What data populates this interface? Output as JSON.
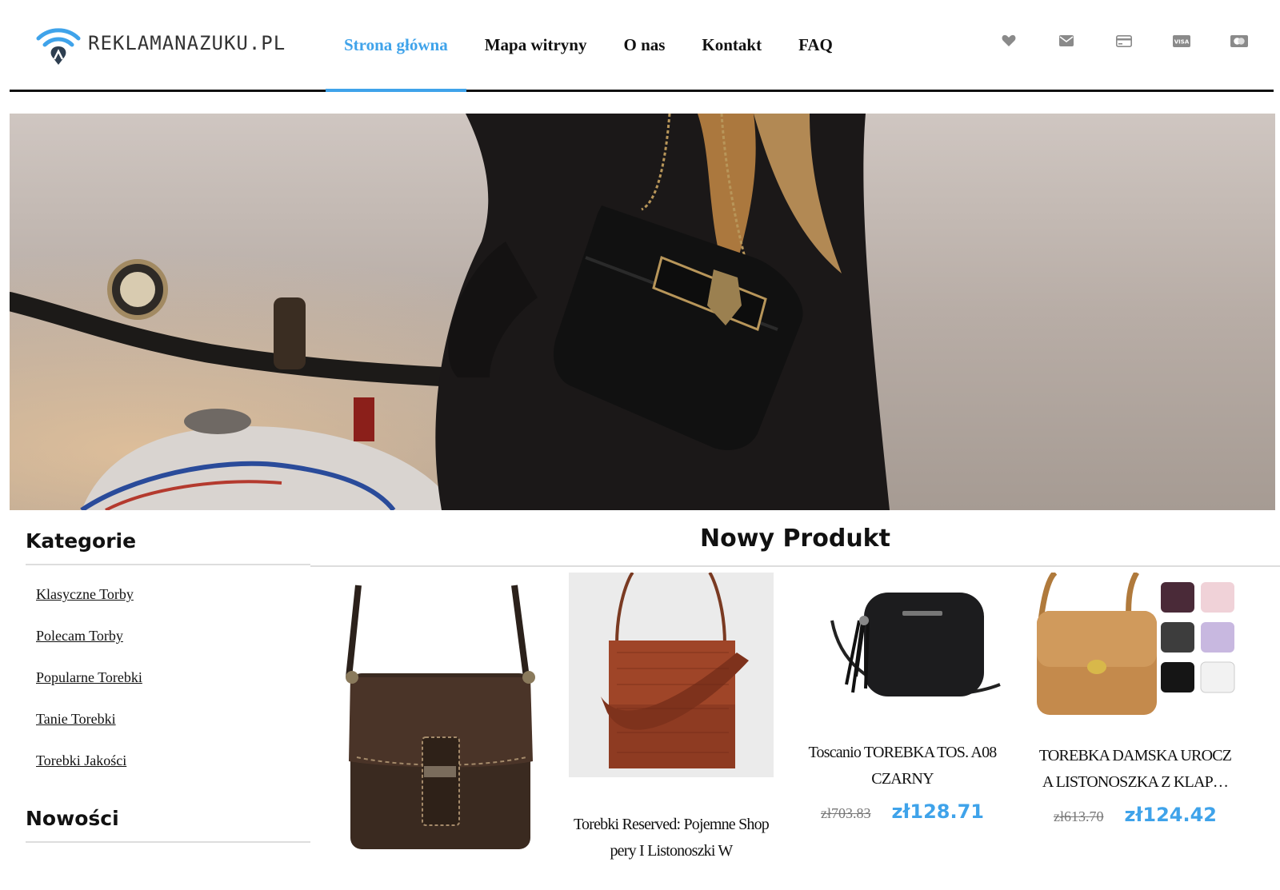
{
  "header": {
    "logo_text": "REKLAMANAZUKU.PL",
    "nav": [
      {
        "label": "Strona główna",
        "active": true
      },
      {
        "label": "Mapa witryny",
        "active": false
      },
      {
        "label": "O nas",
        "active": false
      },
      {
        "label": "Kontakt",
        "active": false
      },
      {
        "label": "FAQ",
        "active": false
      }
    ],
    "icons": [
      "heart-icon",
      "envelope-icon",
      "credit-card-icon",
      "visa-icon",
      "mastercard-icon"
    ],
    "visa_text": "VISA"
  },
  "colors": {
    "accent": "#3fa3ea",
    "text": "#111111"
  },
  "sidebar": {
    "categories_title": "Kategorie",
    "categories": [
      "Klasyczne Torby",
      "Polecam Torby",
      "Popularne Torebki",
      "Tanie Torebki",
      "Torebki Jakości"
    ],
    "news_title": "Nowości"
  },
  "main": {
    "section_title": "Nowy Produkt",
    "products": [
      {
        "name": "",
        "old_price": "",
        "price": ""
      },
      {
        "name": "Torebki Reserved: Pojemne Shop pery I Listonoszki W",
        "old_price": "",
        "price": ""
      },
      {
        "name": "Toscanio TOREBKA TOS. A08 CZARNY",
        "old_price": "zł703.83",
        "price": "zł128.71"
      },
      {
        "name": "TOREBKA DAMSKA UROCZ A LISTONOSZKA Z KLAP…",
        "old_price": "zł613.70",
        "price": "zł124.42"
      }
    ]
  }
}
